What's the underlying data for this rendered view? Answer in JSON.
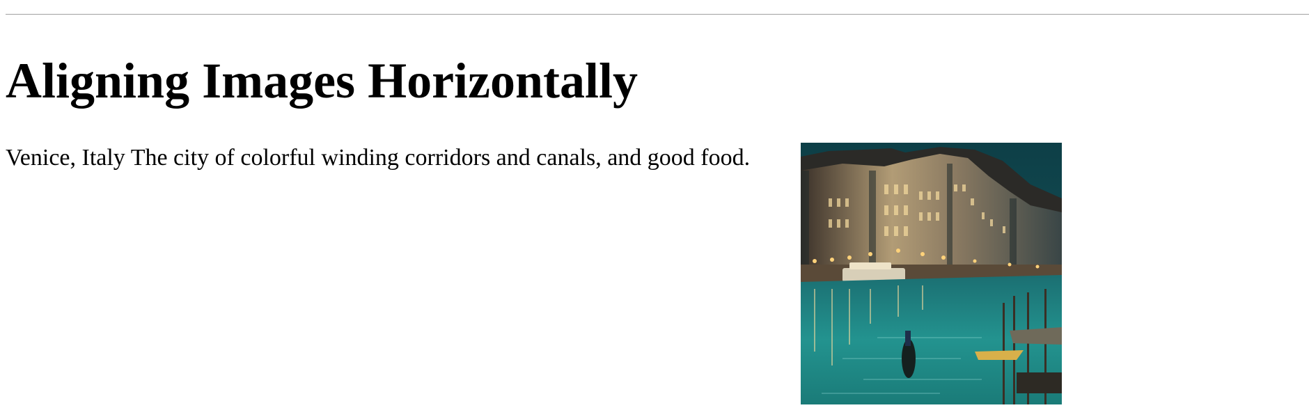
{
  "header": {
    "clipped_line": ""
  },
  "main": {
    "title": "Aligning Images Horizontally",
    "paragraph": "Venice, Italy The city of colorful winding corridors and canals, and good food.",
    "image": {
      "subject": "venice-grand-canal-night",
      "colors": {
        "sky": "#0f4a52",
        "water": "#1f8f8c",
        "buildings_dark": "#2a2622",
        "buildings_light": "#c9b48a",
        "lights": "#ffd27a"
      }
    }
  }
}
